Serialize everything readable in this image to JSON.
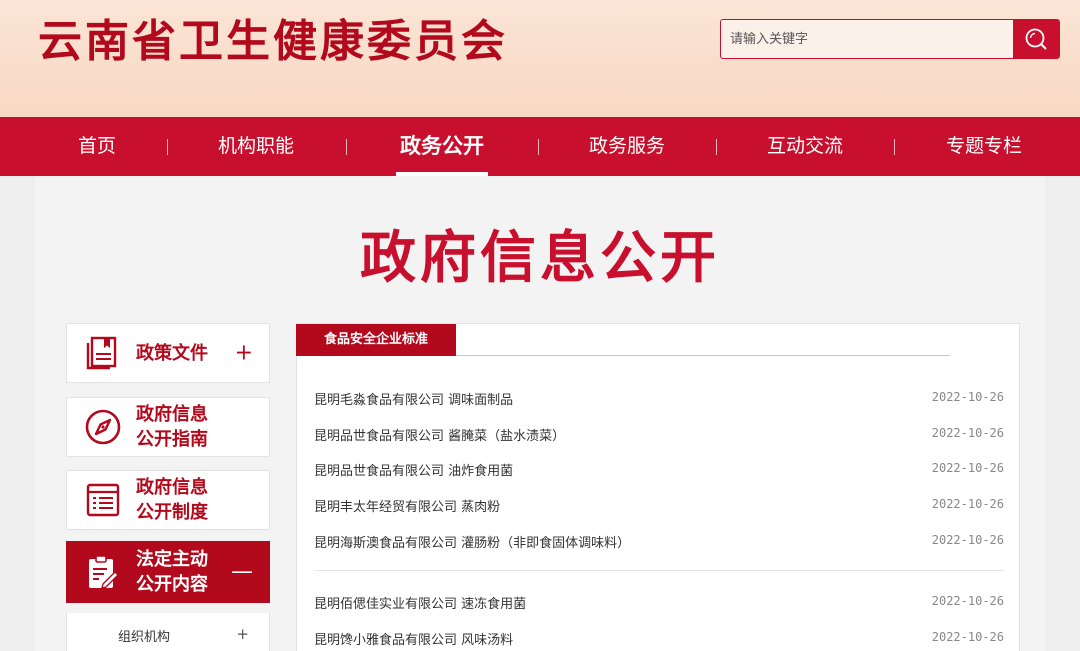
{
  "header": {
    "site_title": "云南省卫生健康委员会",
    "search_placeholder": "请输入关键字"
  },
  "nav": {
    "items": [
      {
        "label": "首页"
      },
      {
        "label": "机构职能"
      },
      {
        "label": "政务公开",
        "active": true
      },
      {
        "label": "政务服务"
      },
      {
        "label": "互动交流"
      },
      {
        "label": "专题专栏"
      }
    ]
  },
  "page_title": "政府信息公开",
  "side_menu": {
    "items": [
      {
        "label": "政策文件",
        "icon": "document-icon",
        "sign": "+"
      },
      {
        "label": "政府信息\n公开指南",
        "icon": "compass-icon"
      },
      {
        "label": "政府信息\n公开制度",
        "icon": "list-document-icon"
      },
      {
        "label": "法定主动\n公开内容",
        "icon": "clipboard-edit-icon",
        "sign": "—",
        "active": true
      }
    ],
    "sub_items": [
      {
        "label": "组织机构",
        "sign": "+"
      }
    ]
  },
  "content": {
    "tab_label": "食品安全企业标准",
    "rows": [
      {
        "title": "昆明毛淼食品有限公司 调味面制品",
        "date": "2022-10-26"
      },
      {
        "title": "昆明品世食品有限公司 酱腌菜（盐水渍菜）",
        "date": "2022-10-26"
      },
      {
        "title": "昆明品世食品有限公司 油炸食用菌",
        "date": "2022-10-26"
      },
      {
        "title": "昆明丰太年经贸有限公司 蒸肉粉",
        "date": "2022-10-26"
      },
      {
        "title": "昆明海斯澳食品有限公司 灌肠粉（非即食固体调味料）",
        "date": "2022-10-26"
      },
      {
        "title": "昆明佰偲佳实业有限公司 速冻食用菌",
        "date": "2022-10-26"
      },
      {
        "title": "昆明馋小雅食品有限公司 风味汤料",
        "date": "2022-10-26"
      }
    ]
  },
  "colors": {
    "brand_red": "#c8102e",
    "dark_red": "#b3091d",
    "header_bg": "#fbe5d6"
  }
}
